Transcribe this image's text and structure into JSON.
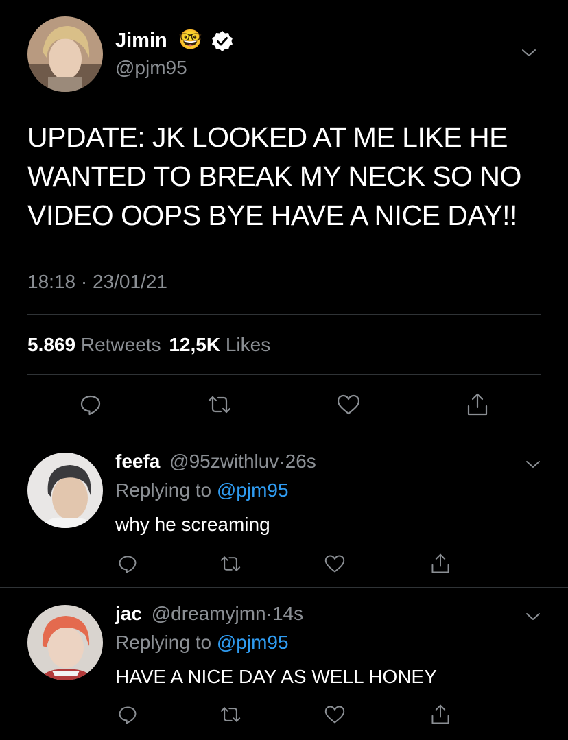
{
  "main_tweet": {
    "author_name": "Jimin",
    "author_emoji": "🤓",
    "handle": "@pjm95",
    "text_lines": [
      "UPDATE: JK LOOKED AT ME LIKE HE",
      "WANTED TO BREAK MY NECK SO NO",
      "VIDEO OOPS BYE HAVE A NICE DAY!!"
    ],
    "time": "18:18",
    "dot": "·",
    "date": "23/01/21",
    "retweets_count": "5.869",
    "retweets_label": "Retweets",
    "likes_count": "12,5K",
    "likes_label": "Likes"
  },
  "replies": [
    {
      "name": "feefa",
      "handle": "@95zwithluv",
      "dot": "·",
      "time": "26s",
      "replying_prefix": "Replying to",
      "replying_to": "@pjm95",
      "text": "why he screaming"
    },
    {
      "name": "jac",
      "handle": "@dreamyjmn",
      "dot": "·",
      "time": "14s",
      "replying_prefix": "Replying to",
      "replying_to": "@pjm95",
      "text": "HAVE A NICE DAY AS WELL HONEY"
    }
  ],
  "icons": [
    "reply-icon",
    "retweet-icon",
    "like-icon",
    "share-icon",
    "chevron-down-icon",
    "verified-badge-icon"
  ],
  "colors": {
    "background": "#000000",
    "text": "#ffffff",
    "muted": "#8b8f94",
    "link": "#2f9bf0",
    "verified": "#ffffff"
  }
}
